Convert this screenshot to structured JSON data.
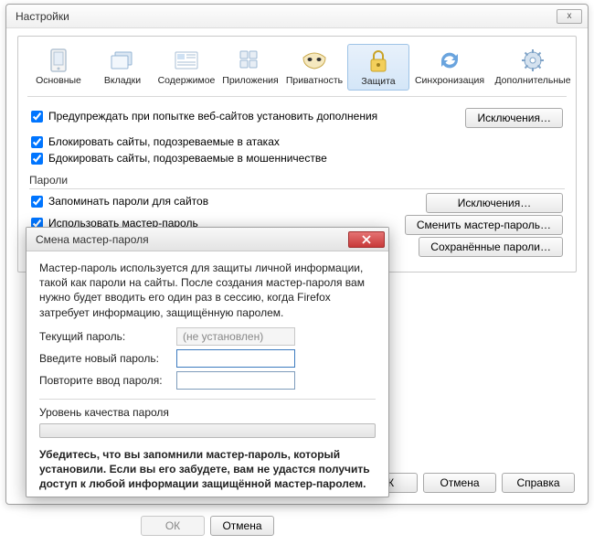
{
  "window": {
    "title": "Настройки",
    "close_glyph": "x"
  },
  "tabs": [
    {
      "label": "Основные",
      "icon": "device"
    },
    {
      "label": "Вкладки",
      "icon": "tabs"
    },
    {
      "label": "Содержимое",
      "icon": "content"
    },
    {
      "label": "Приложения",
      "icon": "apps"
    },
    {
      "label": "Приватность",
      "icon": "privacy"
    },
    {
      "label": "Защита",
      "icon": "security",
      "selected": true
    },
    {
      "label": "Синхронизация",
      "icon": "sync"
    },
    {
      "label": "Дополнительные",
      "icon": "advanced"
    }
  ],
  "security": {
    "addons_warn": {
      "checked": true,
      "label": "Предупреждать при попытке веб-сайтов установить дополнения"
    },
    "exceptions_btn": "Исключения…",
    "block_attacks": {
      "checked": true,
      "label": "Блокировать сайты, подозреваемые в атаках"
    },
    "block_fraud": {
      "checked": true,
      "label": "Бдокировать сайты, подозреваемые в мошенничестве"
    },
    "passwords_section": "Пароли",
    "remember_passwords": {
      "checked": true,
      "label": "Запоминать пароли для сайтов"
    },
    "passwords_exceptions_btn": "Исключения…",
    "use_master": {
      "checked": true,
      "label": "Использовать мастер-пароль"
    },
    "change_master_btn": "Сменить мастер-пароль…",
    "saved_passwords_btn": "Сохранённые пароли…"
  },
  "buttons": {
    "ok": "ОК",
    "cancel": "Отмена",
    "help": "Справка"
  },
  "modal": {
    "title": "Смена мастер-пароля",
    "intro": "Мастер-пароль используется для защиты личной информации, такой как пароли на сайты. После создания мастер-пароля вам нужно будет вводить его один раз в сессию, когда Firefox затребует информацию, защищённую паролем.",
    "current_label": "Текущий пароль:",
    "current_placeholder": "(не установлен)",
    "new_label": "Введите новый пароль:",
    "repeat_label": "Повторите ввод пароля:",
    "quality_label": "Уровень качества пароля",
    "warning": "Убедитесь, что вы запомнили мастер-пароль, который установили. Если вы его забудете, вам не удастся получить доступ к любой информации защищённой мастер-паролем.",
    "ok": "ОК",
    "cancel": "Отмена"
  }
}
